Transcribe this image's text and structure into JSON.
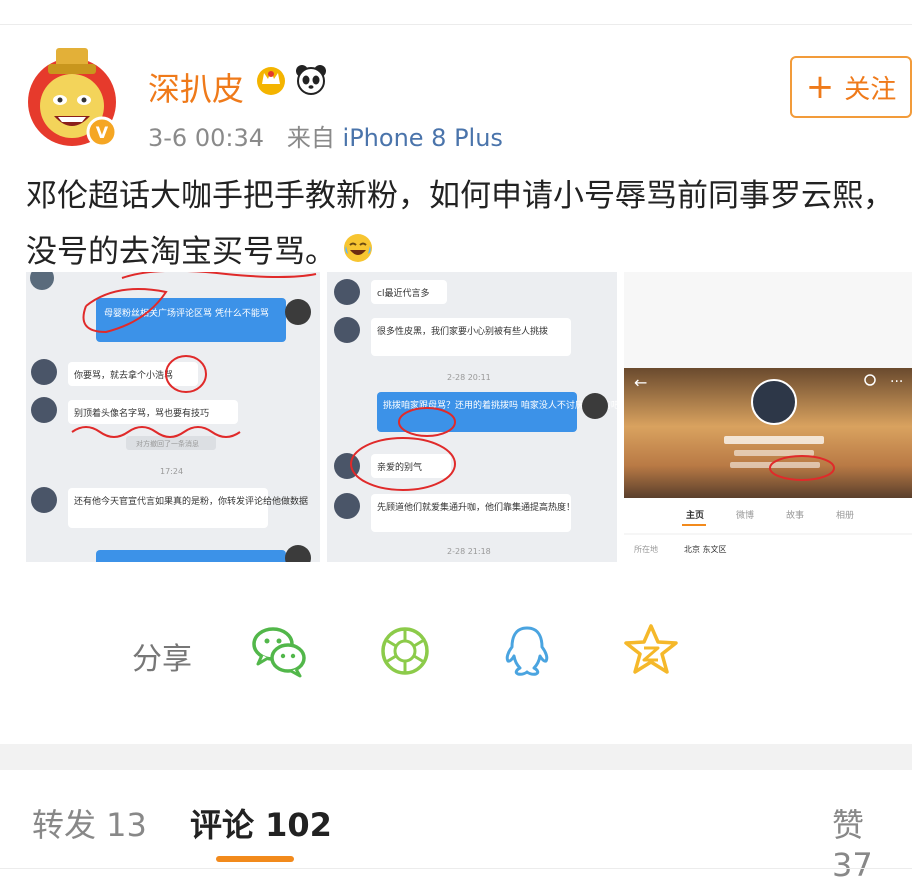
{
  "post": {
    "username": "深扒皮",
    "time": "3-6 00:34",
    "source_prefix": "来自",
    "source": "iPhone 8 Plus",
    "follow_label": "关注",
    "text": "邓伦超话大咖手把手教新粉，如何申请小号辱骂前同事罗云熙，没号的去淘宝买号骂。"
  },
  "images": {
    "img1": {
      "msgs": [
        "母婴粉丝相关广场评论区骂 凭什么不能骂",
        "你要骂，就去拿个小浩骂",
        "别顶着头像名字骂，骂也要有技巧",
        "还有他今天官宣代言如果真的是粉，你转发评论给他做数据"
      ],
      "time": "17:24",
      "system": "对方撤回了一条消息"
    },
    "img2": {
      "msgs": [
        "cl最近代言多",
        "很多性皮黑，我们家要小心别被有些人挑拨",
        "挑拨咱家跟母骂？还用的着挑拨吗 咱家没人不讨厌罗熙的吧",
        "亲爱的别气",
        "先顾道他们就爱集通升咖，他们靠集通提高热度！"
      ],
      "times": [
        "2-28 20:11",
        "2-28 21:18"
      ]
    },
    "img3": {
      "tabs": [
        "主页",
        "微博",
        "故事",
        "相册"
      ],
      "location_label": "所在地",
      "location": "北京 东文区"
    }
  },
  "share": {
    "label": "分享",
    "items": [
      "wechat-icon",
      "moments-icon",
      "qq-icon",
      "qzone-icon"
    ]
  },
  "tabs": {
    "repost": "转发 13",
    "comments": "评论 102",
    "likes": "赞 37"
  },
  "colors": {
    "accent": "#ef7a1a",
    "link": "#4a74ab",
    "wechat": "#52b74a",
    "qq": "#4aa4e0",
    "qzone": "#f5b82a"
  }
}
